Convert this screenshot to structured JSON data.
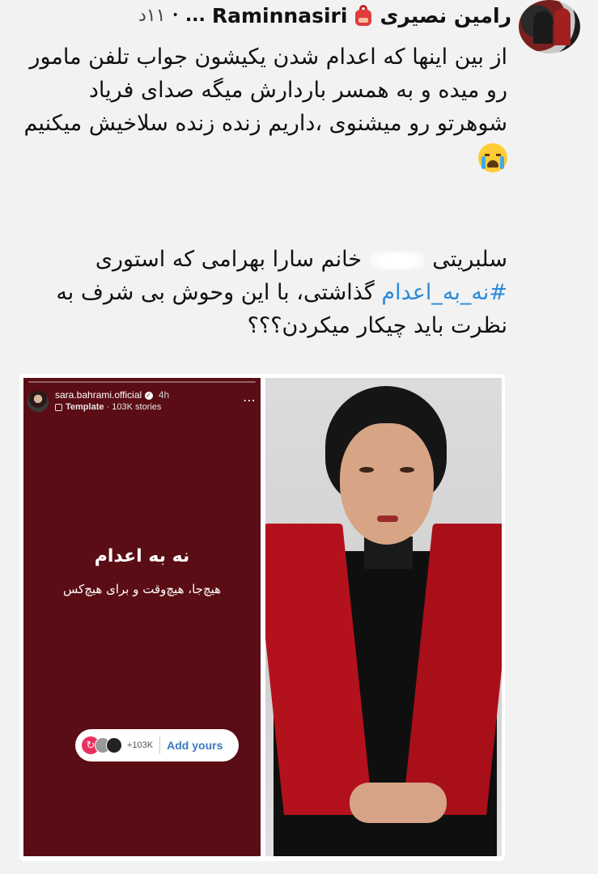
{
  "post": {
    "display_name": "رامین نصیری",
    "handle": "Raminnasiri",
    "handle_ellipsis": "...",
    "dot": "•",
    "time": "۱۱د",
    "emoji_backpack": "backpack-icon",
    "paragraph1": "از بین اینها که اعدام شدن یکیشون جواب تلفن مامور رو میده و به همسر باردارش میگه صدای فریاد شوهرتو رو میشنوی ،داریم زنده زنده سلاخیش میکنیم",
    "paragraph1_emoji": "loudly-crying-face-icon",
    "paragraph2_start": "سلبریتی",
    "paragraph2_mid": "خانم سارا بهرامی که استوری",
    "paragraph2_hashtag": "#نه_به_اعدام",
    "paragraph2_end": "گذاشتی، با این وحوش بی شرف به نظرت باید چیکار میکردن؟؟؟"
  },
  "story": {
    "username": "sara.bahrami.official",
    "age": "4h",
    "template_label": "Template",
    "template_count": "103K stories",
    "title": "نه به اعدام",
    "subtitle": "هیچ‌جا، هیچ‌وقت و برای هیچ‌کس",
    "participants": "+103K",
    "add_yours": "Add yours",
    "background_color": "#5a0d14"
  },
  "colors": {
    "hashtag": "#2b8ad8",
    "page_background": "#f2f2f2"
  }
}
